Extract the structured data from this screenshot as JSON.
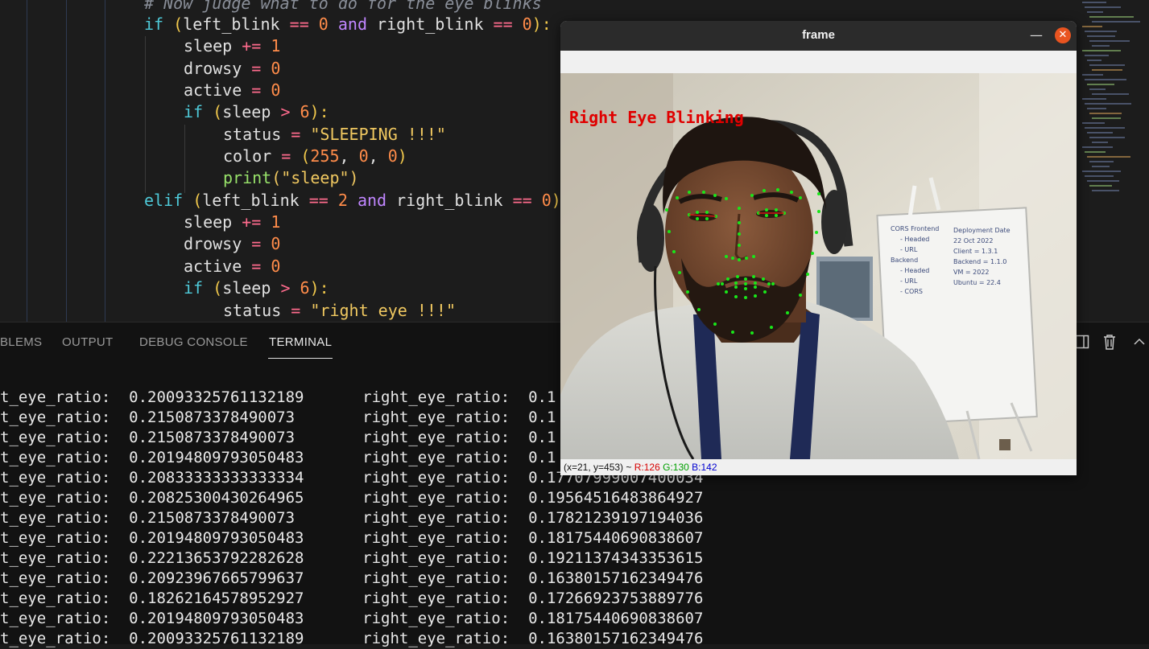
{
  "editor": {
    "comment": "# Now judge what to do for the eye blinks",
    "if1": {
      "kw": "if",
      "open": " (",
      "a": "left_blink",
      "op1": " == ",
      "n1": "0",
      "and": " and ",
      "b": "right_blink",
      "op2": " == ",
      "n2": "0",
      "close": "):"
    },
    "sleep_inc": {
      "var": "sleep",
      "op": " += ",
      "n": "1"
    },
    "drowsy_set": {
      "var": "drowsy",
      "op": " = ",
      "n": "0"
    },
    "active_set": {
      "var": "active",
      "op": " = ",
      "n": "0"
    },
    "if_sleep": {
      "kw": "if",
      "open": " (",
      "var": "sleep",
      "op": " > ",
      "n": "6",
      "close": "):"
    },
    "status_sleeping": {
      "var": "status",
      "op": " = ",
      "s": "\"SLEEPING !!!\""
    },
    "color_set": {
      "var": "color",
      "op": " = ",
      "open": "(",
      "n1": "255",
      "c1": ", ",
      "n2": "0",
      "c2": ", ",
      "n3": "0",
      "close": ")"
    },
    "print_sleep": {
      "fn": "print",
      "args": "(\"sleep\")"
    },
    "elif": {
      "kw": "elif",
      "open": " (",
      "a": "left_blink",
      "op1": " == ",
      "n1": "2",
      "and": " and ",
      "b": "right_blink",
      "op2": " == ",
      "n2": "0",
      "close": ")"
    },
    "status_right": {
      "var": "status",
      "op": " = ",
      "s": "\"right eye !!!\""
    }
  },
  "panel": {
    "tabs": [
      "BLEMS",
      "OUTPUT",
      "DEBUG CONSOLE",
      "TERMINAL"
    ],
    "active_tab": "TERMINAL",
    "split_icon": "split-editor-icon",
    "trash_icon": "trash-icon",
    "chevron_icon": "chevron-up-icon"
  },
  "terminal": {
    "left_label": "t_eye_ratio:  ",
    "right_label": "right_eye_ratio:  ",
    "rows": [
      {
        "l": "0.20093325761132189",
        "r": "0.1"
      },
      {
        "l": "0.2150873378490073",
        "r": "0.1"
      },
      {
        "l": "0.2150873378490073",
        "r": "0.1"
      },
      {
        "l": "0.20194809793050483",
        "r": "0.1"
      },
      {
        "l": "0.20833333333333334",
        "r": "0.17707999007400034"
      },
      {
        "l": "0.20825300430264965",
        "r": "0.19564516483864927"
      },
      {
        "l": "0.2150873378490073",
        "r": "0.17821239197194036"
      },
      {
        "l": "0.20194809793050483",
        "r": "0.18175440690838607"
      },
      {
        "l": "0.22213653792282628",
        "r": "0.19211374343353615"
      },
      {
        "l": "0.20923967665799637",
        "r": "0.16380157162349476"
      },
      {
        "l": "0.18262164578952927",
        "r": "0.17266923753889776"
      },
      {
        "l": "0.20194809793050483",
        "r": "0.18175440690838607"
      },
      {
        "l": "0.20093325761132189",
        "r": "0.16380157162349476"
      }
    ]
  },
  "window": {
    "title": "frame",
    "minimize_glyph": "—",
    "maximize_glyph": "☐",
    "close_glyph": "✕",
    "overlay_text": "Right Eye Blinking",
    "overlay_color": "#e00000",
    "landmark_color": "#19e619",
    "status_prefix": "(x=21, y=453) ~ ",
    "status_r": "R:126",
    "status_g": "G:130",
    "status_b": "B:142",
    "whiteboard_lines": [
      "CORS Frontend",
      "- Headed",
      "- URL",
      "Backend",
      "- Headed",
      "- URL",
      "- CORS"
    ],
    "whiteboard_right": [
      "Deployment Date",
      "22 Oct 2022",
      "Client = 1.3.1",
      "Backend = 1.1.0",
      "VM = 2022",
      "Ubuntu = 22.4"
    ]
  }
}
